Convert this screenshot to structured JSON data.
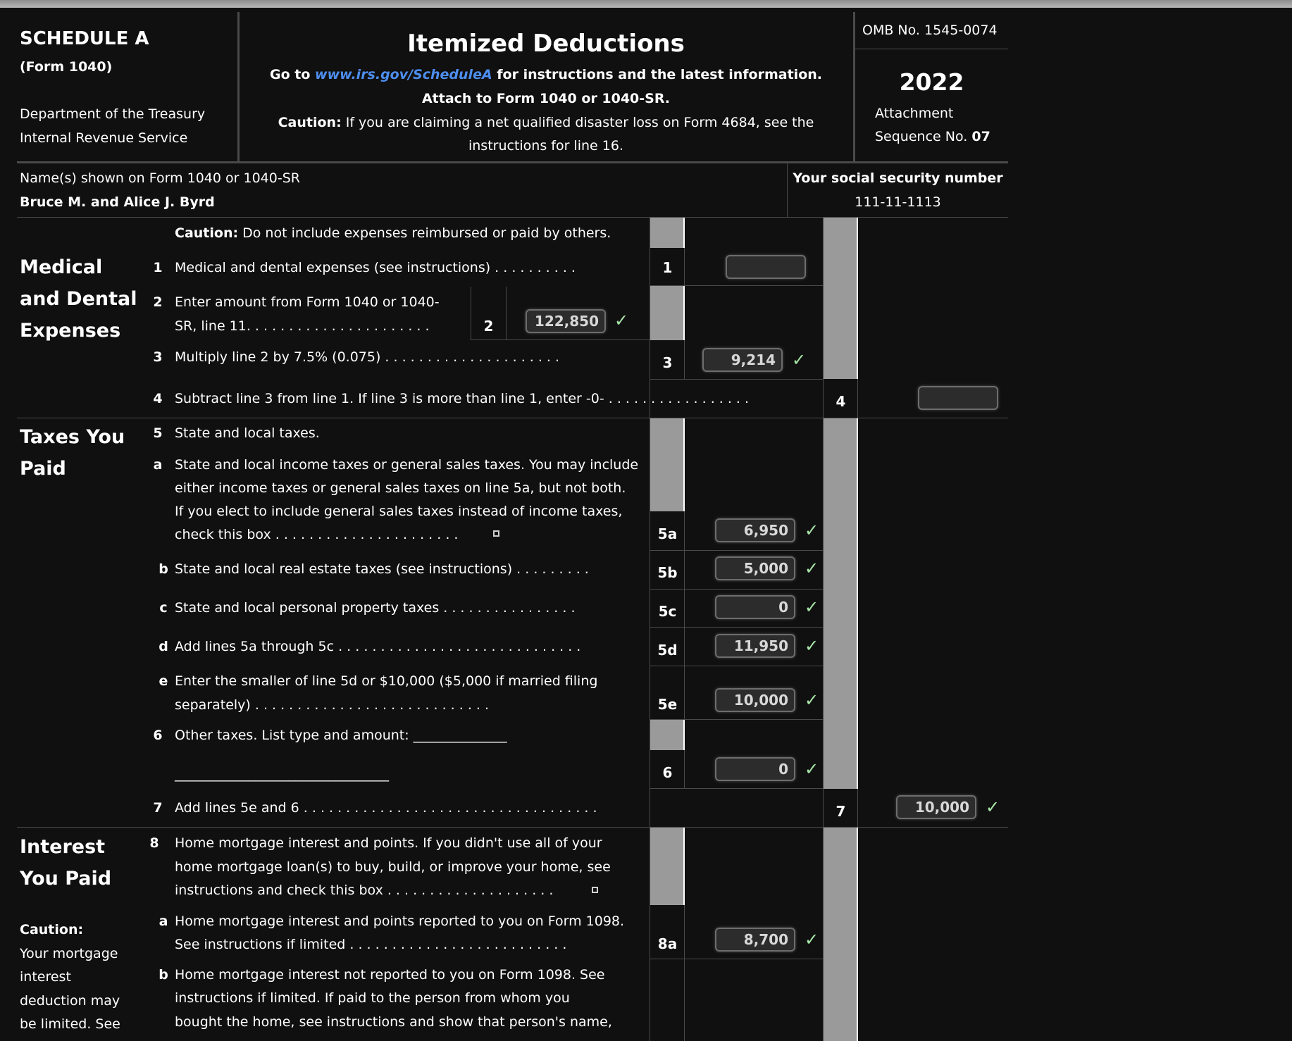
{
  "header": {
    "schedule": "SCHEDULE A",
    "form": "(Form 1040)",
    "department": "Department of the Treasury",
    "service": "Internal Revenue Service",
    "title": "Itemized Deductions",
    "goto_prefix": "Go to ",
    "goto_link": "www.irs.gov/ScheduleA",
    "goto_suffix": " for instructions and the latest information.",
    "attach": "Attach to Form 1040 or 1040-SR.",
    "caution_label": "Caution:",
    "caution_line1": " If you are claiming a net qualified disaster loss on Form 4684, see the",
    "caution_line2": "instructions for line 16.",
    "omb": "OMB No. 1545-0074",
    "year": "2022",
    "attachment": "Attachment",
    "sequence_label": "Sequence No. ",
    "sequence_no": "07"
  },
  "taxpayer": {
    "names_label": "Name(s) shown on Form 1040 or 1040-SR",
    "names_value": "Bruce M. and Alice J. Byrd",
    "ssn_label": "Your social security number",
    "ssn_value": "111-11-1113"
  },
  "medical": {
    "section_title": [
      "Medical",
      "and Dental",
      "Expenses"
    ],
    "caution_label": "Caution:",
    "caution_text": " Do not include expenses reimbursed or paid by others.",
    "line1": {
      "num": "1",
      "text": "Medical and dental expenses (see instructions) . . . . . . . . . .",
      "box": "1",
      "value": ""
    },
    "line2": {
      "num": "2",
      "text1": "Enter amount from Form 1040 or 1040-",
      "text2": "SR, line 11. . . . . . . . . . . . . . . . . . . . . .",
      "box": "2",
      "value": "122,850",
      "verified": true
    },
    "line3": {
      "num": "3",
      "text": "Multiply line 2 by 7.5% (0.075) . . . . . . . . . . . . . . . . . . . . .",
      "box": "3",
      "value": "9,214",
      "verified": true
    },
    "line4": {
      "num": "4",
      "text": "Subtract line 3 from line 1. If line 3 is more than line 1, enter -0- . . . . . . . . . . . . . . . . .",
      "box": "4",
      "value": ""
    }
  },
  "taxes": {
    "section_title": [
      "Taxes You",
      "Paid"
    ],
    "line5": {
      "num": "5",
      "text": "State and local taxes."
    },
    "line5a": {
      "letter": "a",
      "text": [
        "State and local income taxes or general sales taxes. You may include",
        "either income taxes or general sales taxes on line 5a, but not both.",
        "If you elect to include general sales taxes instead of income taxes,",
        "check this box . . . . . . . . . . . . . . . . . . . . . ."
      ],
      "checked": false,
      "box": "5a",
      "value": "6,950",
      "verified": true
    },
    "line5b": {
      "letter": "b",
      "text": "State and local real estate taxes (see instructions) . . . . . . . . .",
      "box": "5b",
      "value": "5,000",
      "verified": true
    },
    "line5c": {
      "letter": "c",
      "text": "State and local personal property taxes . . . . . . . . . . . . . . . .",
      "box": "5c",
      "value": "0",
      "verified": true
    },
    "line5d": {
      "letter": "d",
      "text": "Add lines 5a through 5c . . . . . . . . . . . . . . . . . . . . . . . . . . . . .",
      "box": "5d",
      "value": "11,950",
      "verified": true
    },
    "line5e": {
      "letter": "e",
      "text": [
        "Enter the smaller of line 5d or $10,000 ($5,000 if married filing",
        "separately) . . . . . . . . . . . . . . . . . . . . . . . . . . . ."
      ],
      "box": "5e",
      "value": "10,000",
      "verified": true
    },
    "line6": {
      "num": "6",
      "text": "Other taxes. List type and amount: ______________",
      "blank": "________________________________",
      "box": "6",
      "value": "0",
      "verified": true
    },
    "line7": {
      "num": "7",
      "text": "Add lines 5e and 6 . . . . . . . . . . . . . . . . . . . . . . . . . . . . . . . . . . .",
      "box": "7",
      "value": "10,000",
      "verified": true
    }
  },
  "interest": {
    "section_title": [
      "Interest",
      "You Paid"
    ],
    "caution_label": "Caution:",
    "caution_text": [
      "Your mortgage",
      "interest",
      "deduction may",
      "be limited. See"
    ],
    "line8": {
      "num": "8",
      "text": [
        "Home mortgage interest and points. If you didn't use all of your",
        "home mortgage loan(s) to buy, build, or improve your home, see",
        "instructions and check this box . . . . . . . . . . . . . . . . . . . ."
      ],
      "checked": false
    },
    "line8a": {
      "letter": "a",
      "text": [
        "Home mortgage interest and points reported to you on Form 1098.",
        "See instructions if limited . . . . . . . . . . . . . . . . . . . . . . . . . ."
      ],
      "box": "8a",
      "value": "8,700",
      "verified": true
    },
    "line8b": {
      "letter": "b",
      "text": [
        "Home mortgage interest not reported to you on Form 1098. See",
        "instructions if limited. If paid to the person from whom you",
        "bought the home, see instructions and show that person's name,"
      ]
    }
  },
  "icons": {
    "check": "✓"
  },
  "colors": {
    "verified": "#a8e6a8",
    "link": "#4d8ef0",
    "shade": "#999a99"
  }
}
